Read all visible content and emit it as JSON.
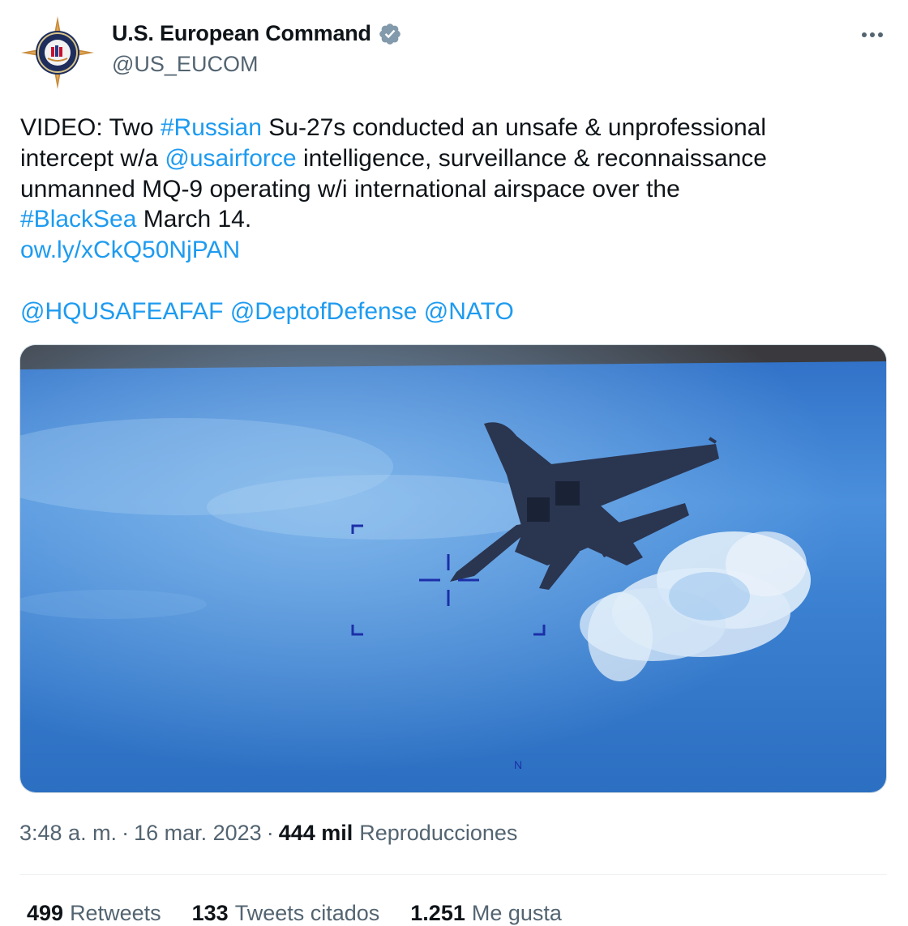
{
  "author": {
    "display_name": "U.S. European Command",
    "handle": "@US_EUCOM",
    "verified_icon": "verified-badge-icon",
    "avatar_icon": "eucom-seal-icon"
  },
  "more_icon": "more-options-icon",
  "tweet": {
    "line1": {
      "t1": "VIDEO: Two ",
      "hashtag_russian": "#Russian",
      "t2": " Su-27s conducted an unsafe & unprofessional"
    },
    "line2": {
      "t1": "intercept w/a ",
      "mention_usairforce": "@usairforce",
      "t2": " intelligence, surveillance & reconnaissance"
    },
    "line3": "unmanned MQ-9 operating w/i international airspace over the",
    "line4": {
      "hashtag_blacksea": "#BlackSea",
      "t1": " March 14."
    },
    "short_link": "ow.ly/xCkQ50NjPAN",
    "mentions": [
      "@HQUSAFEAFAF",
      "@DeptofDefense",
      "@NATO"
    ]
  },
  "media": {
    "overlay_letter": "N"
  },
  "meta": {
    "time": "3:48 a. m.",
    "separator": "·",
    "date": "16 mar. 2023",
    "views_count": "444 mil",
    "views_label": "Reproducciones"
  },
  "stats": [
    {
      "num": "499",
      "label": "Retweets"
    },
    {
      "num": "133",
      "label": "Tweets citados"
    },
    {
      "num": "1.251",
      "label": "Me gusta"
    }
  ],
  "colors": {
    "link": "#1d9bf0",
    "text": "#0f1419",
    "secondary": "#536471",
    "sky": "#3a7fd0"
  }
}
